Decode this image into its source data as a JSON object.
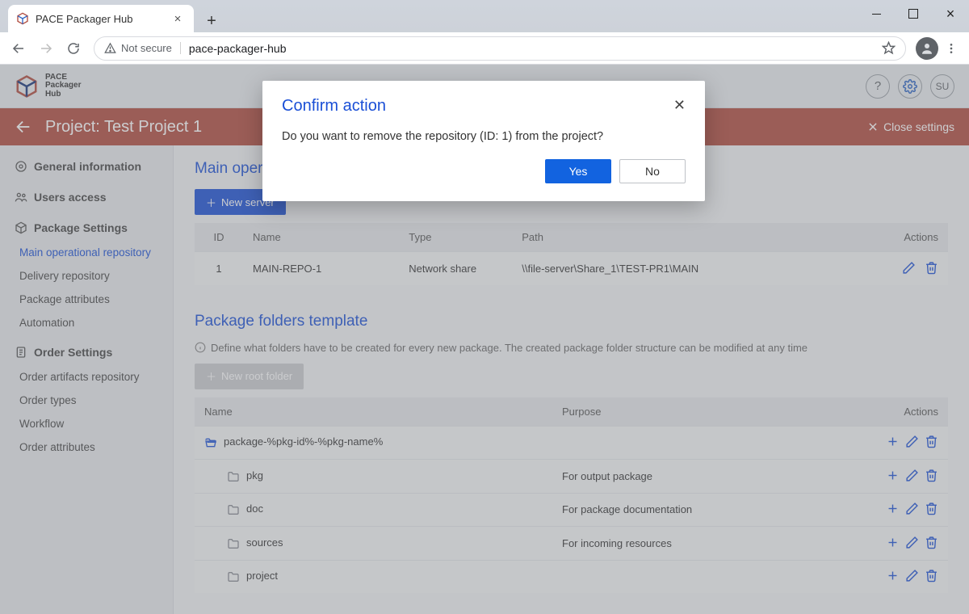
{
  "browser": {
    "tab_title": "PACE Packager Hub",
    "not_secure": "Not secure",
    "url": "pace-packager-hub"
  },
  "app_header": {
    "brand_line1": "PACE",
    "brand_line2": "Packager",
    "brand_line3": "Hub",
    "user_initials": "SU"
  },
  "project_bar": {
    "title": "Project: Test Project 1",
    "close": "Close settings"
  },
  "sidebar": {
    "general": "General information",
    "users": "Users access",
    "pkg_settings": "Package Settings",
    "pkg_items": [
      "Main operational repository",
      "Delivery repository",
      "Package attributes",
      "Automation"
    ],
    "order_settings": "Order Settings",
    "order_items": [
      "Order artifacts repository",
      "Order types",
      "Workflow",
      "Order attributes"
    ]
  },
  "main": {
    "repo_section_title": "Main operational repository",
    "new_server": "New server",
    "repo_headers": {
      "id": "ID",
      "name": "Name",
      "type": "Type",
      "path": "Path",
      "actions": "Actions"
    },
    "repo_row": {
      "id": "1",
      "name": "MAIN-REPO-1",
      "type": "Network share",
      "path": "\\\\file-server\\Share_1\\TEST-PR1\\MAIN"
    },
    "folders_section_title": "Package folders template",
    "folders_hint": "Define what folders have to be created for every new package. The created package folder structure can be modified at any time",
    "new_root": "New root folder",
    "folders_headers": {
      "name": "Name",
      "purpose": "Purpose",
      "actions": "Actions"
    },
    "folders": [
      {
        "name": "package-%pkg-id%-%pkg-name%",
        "purpose": "",
        "root": true
      },
      {
        "name": "pkg",
        "purpose": "For output package"
      },
      {
        "name": "doc",
        "purpose": "For package documentation"
      },
      {
        "name": "sources",
        "purpose": "For incoming resources"
      },
      {
        "name": "project",
        "purpose": ""
      }
    ]
  },
  "dialog": {
    "title": "Confirm action",
    "message": "Do you want to remove the repository (ID: 1) from the project?",
    "yes": "Yes",
    "no": "No"
  }
}
